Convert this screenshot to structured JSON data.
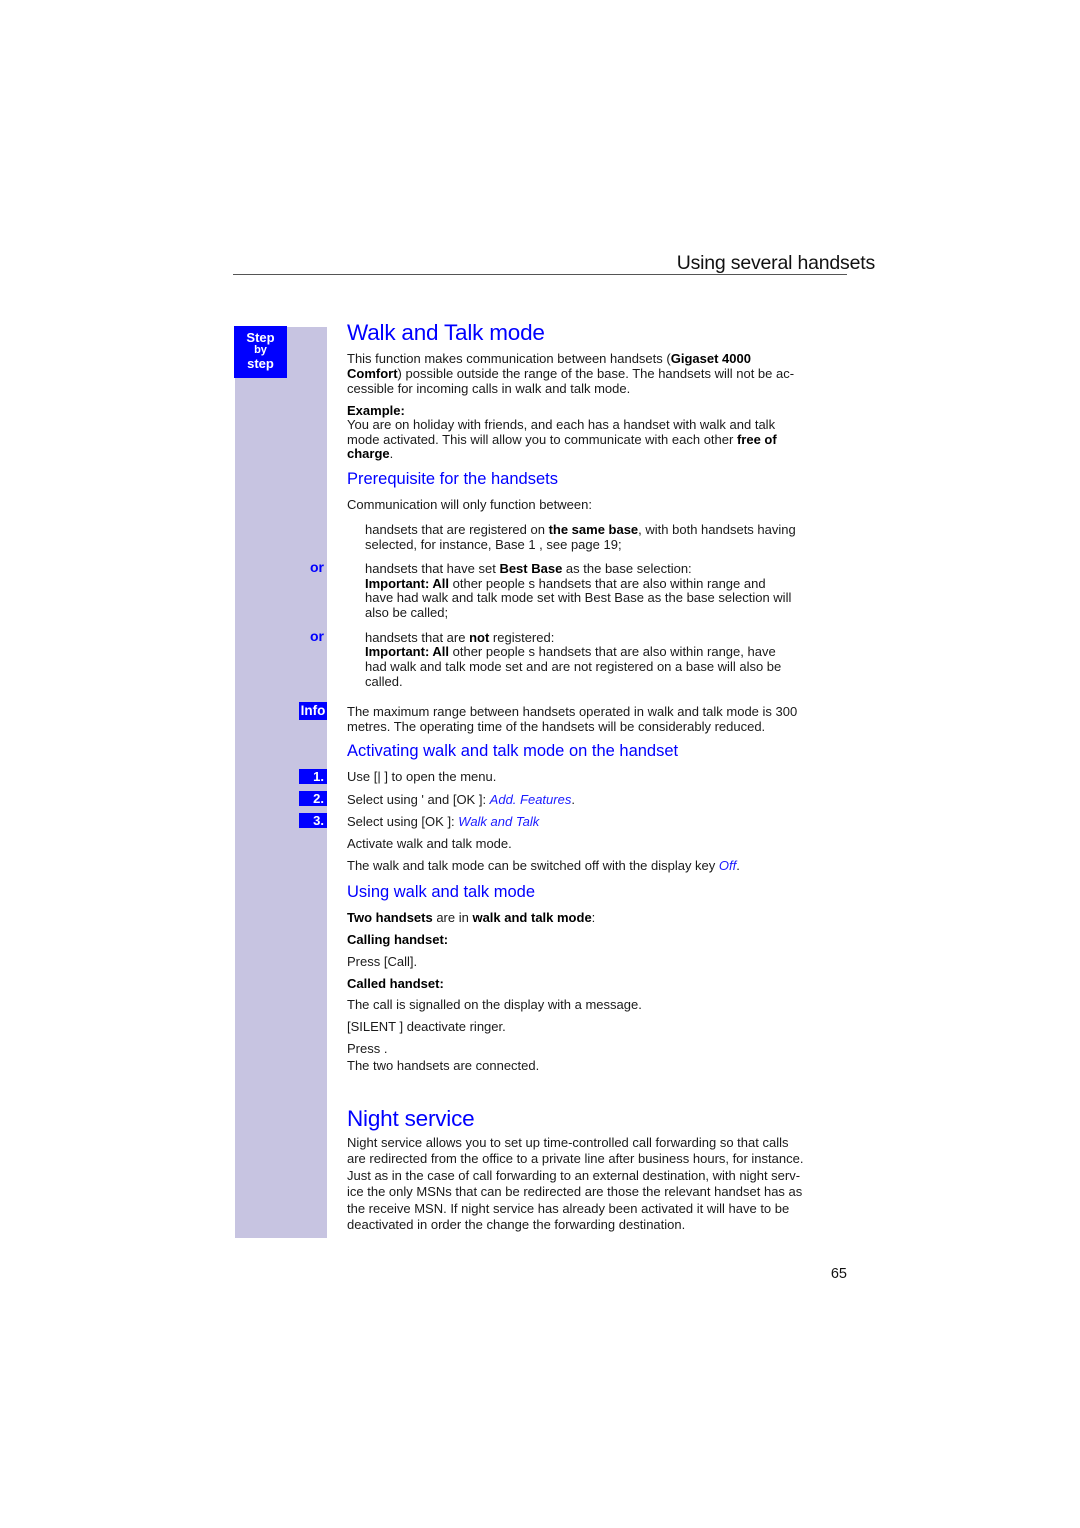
{
  "header": {
    "running_title": "Using several handsets",
    "page_number": "65"
  },
  "sidebar": {
    "step_badge": [
      "Step",
      "by",
      "step"
    ],
    "or_label": "or",
    "info_label": "Info",
    "steps": [
      "1.",
      "2.",
      "3."
    ]
  },
  "colors": {
    "accent_blue": "#0000ff",
    "sidebar_lavender": "#c7c4e1",
    "body_text": "#1a1a1a"
  },
  "walk_talk": {
    "title": "Walk and Talk mode",
    "intro": {
      "p1_a": "This function makes communication between handsets (",
      "p1_b": "Gigaset 4000",
      "p2_a": "Comfort",
      "p2_b": ") possible outside the range of the base. The handsets will not be ac-",
      "p3": "cessible for incoming calls in walk and talk mode."
    },
    "example": {
      "label": "Example:",
      "l1": "You are on holiday with friends, and each has a handset with walk and talk",
      "l2_a": "mode activated. This will allow you to communicate with each other ",
      "l2_b": "free of",
      "l3_a": "charge",
      "l3_b": "."
    }
  },
  "prerequisite": {
    "title": "Prerequisite for the handsets",
    "lead": "Communication will only function between:",
    "item1": {
      "l1_a": "handsets that are registered on ",
      "l1_b": "the same base",
      "l1_c": ", with both handsets having",
      "l2": "selected, for instance,   Base 1 , see page 19;"
    },
    "item2": {
      "l1_a": "handsets that have set   ",
      "l1_b": "Best Base",
      "l1_c": "   as the base selection:",
      "l2_a": "Important: All",
      "l2_b": "   other people s   handsets that are also within range and",
      "l3": "have had walk and talk mode set with   Best Base   as the base selection will",
      "l4": "also be called;"
    },
    "item3": {
      "l1_a": "handsets that are ",
      "l1_b": "not",
      "l1_c": " registered:",
      "l2_a": "Important: All",
      "l2_b": "   other people s   handsets that are also within range, have",
      "l3": "had walk and talk mode set and are not registered on a base will also be",
      "l4": "called."
    },
    "info": {
      "l1": "The maximum range between handsets operated in walk and talk mode is 300",
      "l2": "metres. The operating time of the handsets will be considerably reduced."
    }
  },
  "activating": {
    "title": "Activating walk and talk mode on the handset",
    "step1": "Use [|    ] to open the menu.",
    "step2_a": "Select using '      and [OK ]: ",
    "step2_b": "Add. Features",
    "step2_c": ".",
    "step3_a": "Select using [OK ]: ",
    "step3_b": "Walk and Talk",
    "note1": "Activate walk and talk mode.",
    "note2_a": "The walk and talk mode can be switched off with the display key ",
    "note2_b": "Off",
    "note2_c": "."
  },
  "using": {
    "title": "Using walk and talk mode",
    "status_a": "Two handsets",
    "status_b": " are in ",
    "status_c": "walk and talk mode",
    "status_d": ":",
    "calling_label": "Calling handset:",
    "calling_action": "Press [Call].",
    "called_label": "Called handset:",
    "called_1": "The call is signalled on the display with a message.",
    "called_2": "[SILENT ] deactivate ringer.",
    "called_3": "Press        .",
    "called_4": "The two handsets are connected."
  },
  "night_service": {
    "title": "Night service",
    "lines": [
      "Night service allows you to set up time-controlled call forwarding so that calls",
      "are redirected from the office to a private line after business hours, for instance.",
      "Just as in the case of call forwarding to an external destination, with night serv-",
      "ice the only MSNs that can be redirected are those the relevant handset has as",
      "the receive MSN. If night service has already been activated it will have to be",
      "deactivated in order the change the forwarding destination."
    ]
  }
}
